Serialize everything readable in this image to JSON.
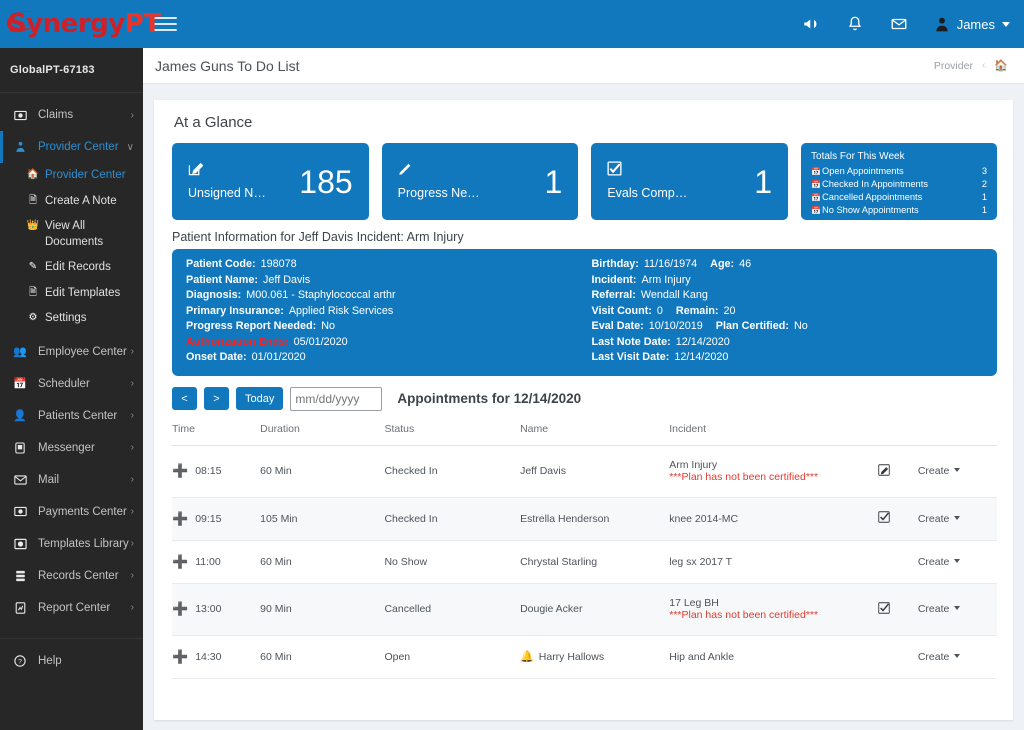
{
  "brand": {
    "logo_text_1": "Synergy",
    "logo_text_2": "PT",
    "accent_blue": "#1278be",
    "accent_red": "#cf2027"
  },
  "topbar": {
    "menu_icon": "hamburger-icon",
    "announcement_icon": "megaphone-icon",
    "notification_icon": "bell-icon",
    "mail_icon": "envelope-icon",
    "user_name": "James"
  },
  "sidebar": {
    "tenant": "GlobalPT-67183",
    "items": [
      {
        "label": "Claims",
        "icon": "claims-icon",
        "chevron": "›",
        "active": false
      },
      {
        "label": "Provider Center",
        "icon": "provider-icon",
        "chevron": "∨",
        "active": true
      }
    ],
    "subitems": [
      {
        "label": "Provider Center",
        "icon": "home-icon",
        "active": true
      },
      {
        "label": "Create A Note",
        "icon": "file-icon",
        "active": false
      },
      {
        "label": "View All Documents",
        "icon": "binoculars-icon",
        "active": false
      },
      {
        "label": "Edit Records",
        "icon": "edit-icon",
        "active": false
      },
      {
        "label": "Edit Templates",
        "icon": "file-icon",
        "active": false
      },
      {
        "label": "Settings",
        "icon": "gear-icon",
        "active": false
      }
    ],
    "items2": [
      {
        "label": "Employee Center",
        "icon": "employee-icon",
        "chevron": "›"
      },
      {
        "label": "Scheduler",
        "icon": "calendar-icon",
        "chevron": "›"
      },
      {
        "label": "Patients Center",
        "icon": "patient-icon",
        "chevron": "›"
      },
      {
        "label": "Messenger",
        "icon": "messenger-icon",
        "chevron": "›"
      },
      {
        "label": "Mail",
        "icon": "envelope-icon",
        "chevron": "›"
      },
      {
        "label": "Payments Center",
        "icon": "payments-icon",
        "chevron": "›"
      },
      {
        "label": "Templates Library",
        "icon": "templates-icon",
        "chevron": "›"
      },
      {
        "label": "Records Center",
        "icon": "records-icon",
        "chevron": "›"
      },
      {
        "label": "Report Center",
        "icon": "report-icon",
        "chevron": "›"
      }
    ],
    "help": {
      "label": "Help",
      "icon": "help-icon"
    }
  },
  "page": {
    "title": "James Guns To Do List",
    "breadcrumb_label": "Provider",
    "breadcrumb_sep": "‹",
    "breadcrumb_home_icon": "home-icon"
  },
  "glance": {
    "heading": "At a Glance",
    "cards": [
      {
        "label": "Unsigned N…",
        "value": "185",
        "icon": "edit-note-icon"
      },
      {
        "label": "Progress Ne…",
        "value": "1",
        "icon": "pencil-icon"
      },
      {
        "label": "Evals Comp…",
        "value": "1",
        "icon": "check-square-icon"
      }
    ],
    "totals": {
      "heading": "Totals For This Week",
      "rows": [
        {
          "label": "Open Appointments",
          "value": "3",
          "icon": "calendar-icon"
        },
        {
          "label": "Checked In Appointments",
          "value": "2",
          "icon": "calendar-icon"
        },
        {
          "label": "Cancelled Appointments",
          "value": "1",
          "icon": "calendar-icon"
        },
        {
          "label": "No Show Appointments",
          "value": "1",
          "icon": "calendar-icon"
        }
      ]
    }
  },
  "patient": {
    "title": "Patient Information for Jeff Davis Incident: Arm Injury",
    "left": [
      {
        "label": "Patient Code:",
        "value": "198078"
      },
      {
        "label": "Patient Name:",
        "value": "Jeff Davis"
      },
      {
        "label": "Diagnosis:",
        "value": "M00.061 - Staphylococcal arthr"
      },
      {
        "label": "Primary Insurance:",
        "value": "Applied Risk Services"
      },
      {
        "label": "Progress Report Needed:",
        "value": "No"
      },
      {
        "label": "Authorization Ends:",
        "value": "05/01/2020",
        "alert": true
      },
      {
        "label": "Onset Date:",
        "value": "01/01/2020"
      }
    ],
    "right": [
      {
        "label": "Birthday:",
        "value": "11/16/1974",
        "label2": "Age:",
        "value2": "46"
      },
      {
        "label": "Incident:",
        "value": "Arm Injury"
      },
      {
        "label": "Referral:",
        "value": "Wendall Kang"
      },
      {
        "label": "Visit Count:",
        "value": "0",
        "label2": "Remain:",
        "value2": "20"
      },
      {
        "label": "Eval Date:",
        "value": "10/10/2019",
        "label2": "Plan Certified:",
        "value2": "No"
      },
      {
        "label": "Last Note Date:",
        "value": "12/14/2020"
      },
      {
        "label": "Last Visit Date:",
        "value": "12/14/2020"
      }
    ]
  },
  "datenav": {
    "prev_label": "<",
    "next_label": ">",
    "today_label": "Today",
    "date_placeholder": "mm/dd/yyyy",
    "date_value": "",
    "appointments_heading": "Appointments for 12/14/2020"
  },
  "table": {
    "columns": [
      "Time",
      "Duration",
      "Status",
      "Name",
      "Incident",
      "",
      ""
    ],
    "rows": [
      {
        "time": "08:15",
        "duration": "60 Min",
        "status": "Checked In",
        "name": "Jeff Davis",
        "incident": "Arm Injury",
        "warning": "***Plan has not been certified***",
        "row_icon": "edit-note-icon",
        "action": "Create",
        "alert_icon": ""
      },
      {
        "time": "09:15",
        "duration": "105 Min",
        "status": "Checked In",
        "name": "Estrella Henderson",
        "incident": "knee 2014-MC",
        "warning": "",
        "row_icon": "check-square-icon",
        "action": "Create",
        "alert_icon": ""
      },
      {
        "time": "11:00",
        "duration": "60 Min",
        "status": "No Show",
        "name": "Chrystal Starling",
        "incident": "leg sx 2017 T",
        "warning": "",
        "row_icon": "",
        "action": "Create",
        "alert_icon": ""
      },
      {
        "time": "13:00",
        "duration": "90 Min",
        "status": "Cancelled",
        "name": "Dougie Acker",
        "incident": "17 Leg BH",
        "warning": "***Plan has not been certified***",
        "row_icon": "check-square-icon",
        "action": "Create",
        "alert_icon": ""
      },
      {
        "time": "14:30",
        "duration": "60 Min",
        "status": "Open",
        "name": "Harry Hallows",
        "incident": "Hip and Ankle",
        "warning": "",
        "row_icon": "",
        "action": "Create",
        "alert_icon": "bell-icon"
      }
    ]
  }
}
